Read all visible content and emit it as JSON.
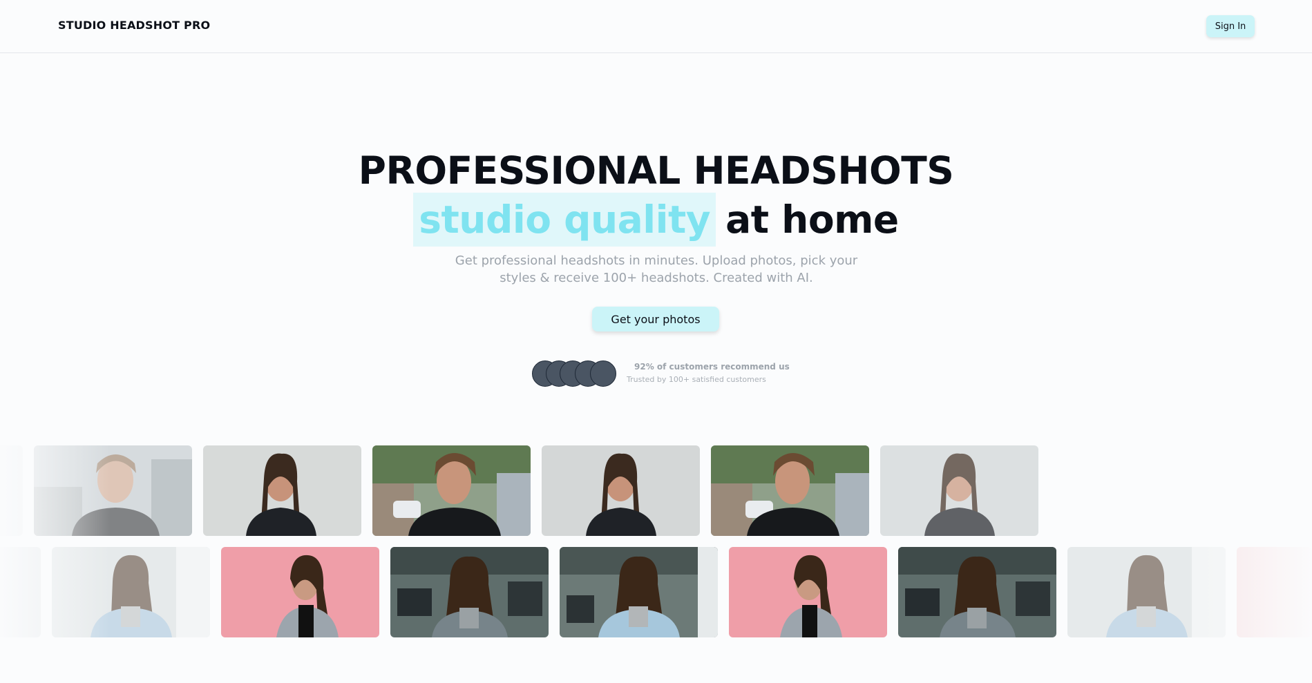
{
  "header": {
    "brand": "STUDIO HEADSHOT PRO",
    "signin_label": "Sign In"
  },
  "hero": {
    "title": "PROFESSIONAL HEADSHOTS",
    "highlight": "studio quality",
    "title_rest": "at home",
    "subtitle_line1": "Get professional headshots in minutes. Upload photos, pick your",
    "subtitle_line2": "styles & receive 100+ headshots. Created with AI.",
    "cta_label": "Get your photos"
  },
  "social_proof": {
    "headline": "92% of customers recommend us",
    "subline": "Trusted by 100+ satisfied customers",
    "avatar_count": 5
  },
  "colors": {
    "accent_bg": "#cbf4f8",
    "highlight_text": "#7fe3f0",
    "text_dark": "#0b0f17",
    "muted": "#9ca3ab"
  },
  "gallery": {
    "row1": [
      "man-street",
      "woman-studio",
      "man-street",
      "woman-studio",
      "man-street",
      "woman-studio"
    ],
    "row2": [
      "woman-office-light",
      "woman-pink",
      "woman-office-dark",
      "woman-office-window",
      "woman-pink",
      "woman-office-dark",
      "woman-office-light"
    ]
  }
}
